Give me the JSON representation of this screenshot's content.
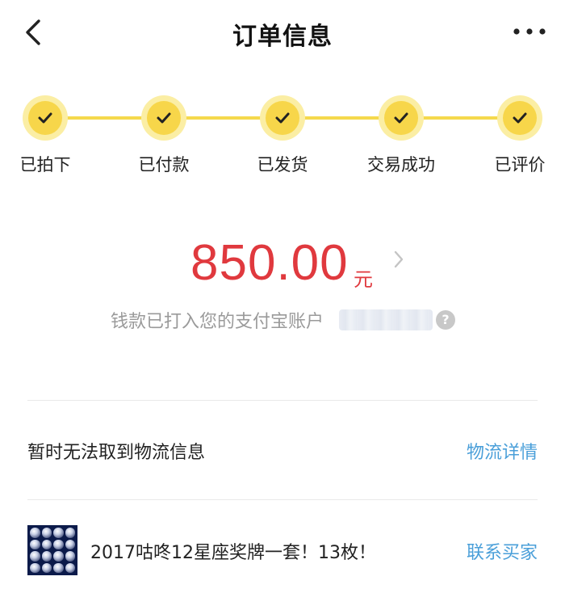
{
  "header": {
    "title": "订单信息"
  },
  "steps": [
    {
      "label": "已拍下"
    },
    {
      "label": "已付款"
    },
    {
      "label": "已发货"
    },
    {
      "label": "交易成功"
    },
    {
      "label": "已评价"
    }
  ],
  "payment": {
    "amount": "850.00",
    "currency": "元",
    "note": "钱款已打入您的支付宝账户"
  },
  "logistics": {
    "status": "暂时无法取到物流信息",
    "link": "物流详情"
  },
  "product": {
    "title": "2017咕咚12星座奖牌一套！13枚！",
    "contact": "联系买家"
  },
  "colors": {
    "accent_yellow": "#f7d64a",
    "price_red": "#e0393e",
    "link_blue": "#4a9fd9"
  }
}
